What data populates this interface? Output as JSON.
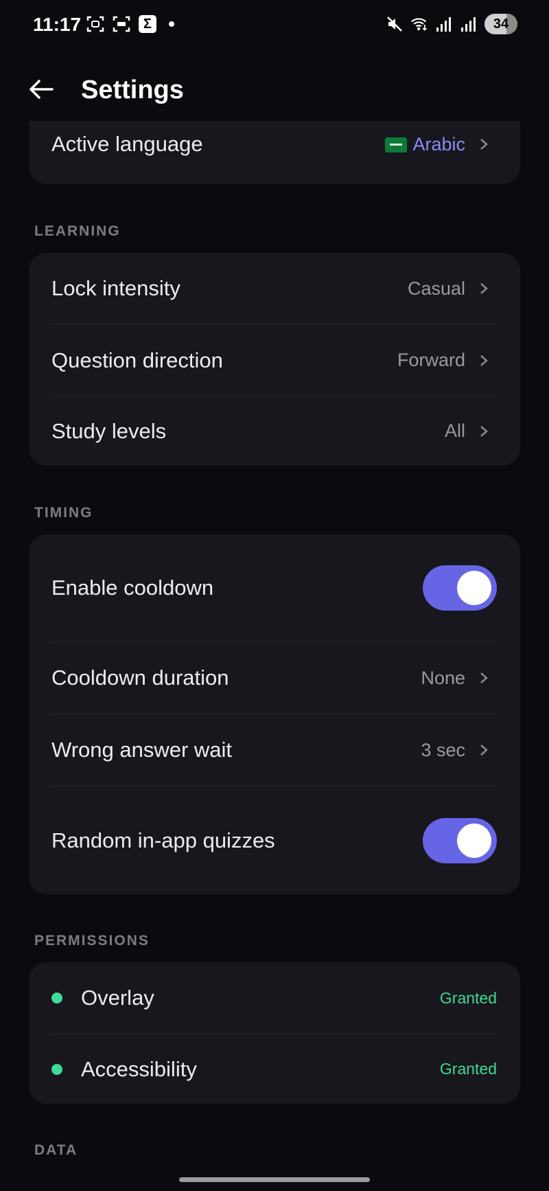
{
  "status_bar": {
    "time": "11:17",
    "battery": "34",
    "icons": [
      "screenshot-icon",
      "scan-icon",
      "sigma-app-icon",
      "notification-dot",
      "mute-icon",
      "wifi-icon",
      "signal-icon",
      "signal-icon-2",
      "battery-icon"
    ]
  },
  "header": {
    "title": "Settings",
    "back_icon": "arrow-left-icon"
  },
  "language": {
    "label": "Active language",
    "value": "Arabic",
    "flag_icon": "saudi-flag-icon"
  },
  "learning": {
    "section_title": "LEARNING",
    "items": [
      {
        "label": "Lock intensity",
        "value": "Casual"
      },
      {
        "label": "Question direction",
        "value": "Forward"
      },
      {
        "label": "Study levels",
        "value": "All"
      }
    ]
  },
  "timing": {
    "section_title": "TIMING",
    "enable_cooldown": {
      "label": "Enable cooldown",
      "on": true
    },
    "cooldown_duration": {
      "label": "Cooldown duration",
      "value": "None"
    },
    "wrong_answer_wait": {
      "label": "Wrong answer wait",
      "value": "3 sec"
    },
    "random_quizzes": {
      "label": "Random in-app quizzes",
      "on": true
    }
  },
  "permissions": {
    "section_title": "PERMISSIONS",
    "items": [
      {
        "label": "Overlay",
        "status": "Granted"
      },
      {
        "label": "Accessibility",
        "status": "Granted"
      }
    ]
  },
  "data_section": {
    "section_title": "DATA"
  },
  "colors": {
    "accent": "#6665e6",
    "granted": "#3ddc97",
    "card": "#17171d",
    "background": "#0b0b0f"
  }
}
